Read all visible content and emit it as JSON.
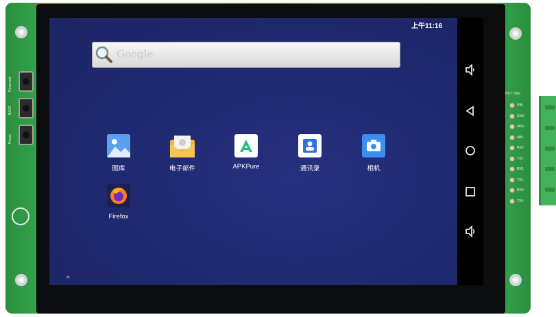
{
  "status_bar": {
    "time": "上午11:16"
  },
  "search": {
    "placeholder": "Google"
  },
  "apps": [
    {
      "label": "图库",
      "icon": "gallery-icon"
    },
    {
      "label": "电子邮件",
      "icon": "email-icon"
    },
    {
      "label": "APKPure",
      "icon": "apkpure-icon"
    },
    {
      "label": "通讯录",
      "icon": "contacts-icon"
    },
    {
      "label": "相机",
      "icon": "camera-icon"
    },
    {
      "label": "Firefox",
      "icon": "firefox-icon"
    }
  ],
  "nav_bar": [
    "volume-down-icon",
    "back-icon",
    "home-icon",
    "recents-icon",
    "volume-up-icon"
  ],
  "board": {
    "side_labels": [
      "Reserved",
      "BACK",
      "Power"
    ],
    "connector_title": "DC7~36V",
    "connector_pins": [
      "VIN",
      "GND",
      "485+",
      "485-",
      "RX2",
      "TX2",
      "RX1",
      "TX1",
      "RX4",
      "TX4"
    ]
  }
}
